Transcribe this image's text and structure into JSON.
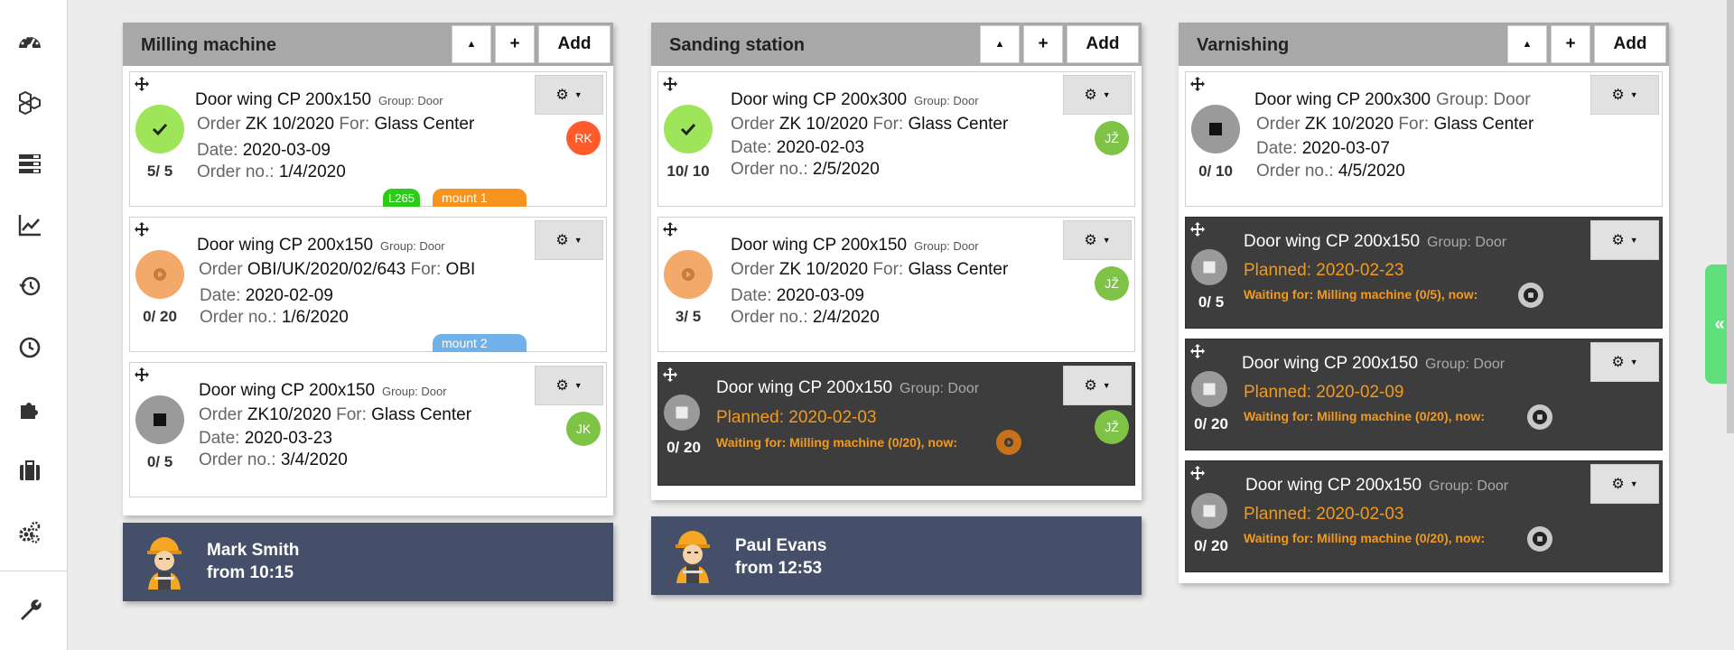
{
  "sidebar": {
    "icons": [
      "dashboard-icon",
      "cubes-icon",
      "list-icon",
      "chart-icon",
      "history-icon",
      "clock-icon",
      "puzzle-icon",
      "briefcase-icon",
      "settings-icon",
      "wrench-icon"
    ]
  },
  "header_buttons": {
    "up": "▲",
    "plus": "+",
    "add": "Add"
  },
  "labels": {
    "group": "Group:",
    "order": "Order",
    "for": "For:",
    "date": "Date:",
    "order_no": "Order no.:",
    "planned": "Planned:",
    "waiting": "Waiting for:",
    "now": "now:"
  },
  "colors": {
    "header": "#a8a8a8",
    "worker_panel": "#454f69",
    "done": "#9ee55a",
    "paused": "#f3a96a",
    "stopped": "#9a9a9a",
    "orange_text": "#f29a1f",
    "side_tab": "#5fe07a"
  },
  "columns": [
    {
      "title": "Milling machine",
      "worker": {
        "name": "Mark Smith",
        "time": "from 10:15"
      },
      "cards": [
        {
          "title": "Door wing CP 200x150",
          "group": "Group: Door",
          "order": "ZK 10/2020",
          "for": "Glass Center",
          "date": "2020-03-09",
          "order_no": "1/4/2020",
          "qty": "5/ 5",
          "status": "done",
          "avatar": "RK",
          "avatar_color": "#ff5a2a",
          "tags": [
            {
              "text": "L265",
              "color": "#2ccc1a"
            },
            {
              "text": "mount 1",
              "color": "#f7941d"
            }
          ]
        },
        {
          "title": "Door wing CP 200x150",
          "group": "Group: Door",
          "order": "OBI/UK/2020/02/643",
          "for": "OBI",
          "date": "2020-02-09",
          "order_no": "1/6/2020",
          "qty": "0/ 20",
          "status": "paused",
          "avatar": "",
          "tags": [
            {
              "text": "mount 2",
              "color": "#6fb1e8"
            }
          ]
        },
        {
          "title": "Door wing CP 200x150",
          "group": "Group: Door",
          "order": "ZK10/2020",
          "for": "Glass Center",
          "date": "2020-03-23",
          "order_no": "3/4/2020",
          "qty": "0/ 5",
          "status": "stopped",
          "avatar": "JK",
          "avatar_color": "#7ec246",
          "tags": []
        }
      ]
    },
    {
      "title": "Sanding station",
      "worker": {
        "name": "Paul Evans",
        "time": "from 12:53"
      },
      "cards": [
        {
          "title": "Door wing CP 200x300",
          "group": "Group: Door",
          "order": "ZK 10/2020",
          "for": "Glass Center",
          "date": "2020-02-03",
          "order_no": "2/5/2020",
          "qty": "10/ 10",
          "status": "done",
          "avatar": "JŽ",
          "avatar_color": "#7ec246"
        },
        {
          "title": "Door wing CP 200x150",
          "group": "Group: Door",
          "order": "ZK 10/2020",
          "for": "Glass Center",
          "date": "2020-03-09",
          "order_no": "2/4/2020",
          "qty": "3/ 5",
          "status": "paused",
          "avatar": "JŽ",
          "avatar_color": "#7ec246"
        },
        {
          "dark": true,
          "title": "Door wing CP 200x150",
          "group": "Group: Door",
          "planned": "Planned: 2020-02-03",
          "waiting": "Waiting for: Milling machine (0/20), now:",
          "qty": "0/ 20",
          "avatar": "JŽ",
          "avatar_color": "#7ec246",
          "wait_icon": "play"
        }
      ]
    },
    {
      "title": "Varnishing",
      "cards": [
        {
          "title": "Door wing CP 200x300",
          "group": "Group: Door",
          "order": "ZK 10/2020",
          "for": "Glass Center",
          "date": "2020-03-07",
          "order_no": "4/5/2020",
          "qty": "0/ 10",
          "status": "stopped",
          "avatar": "",
          "large_group": true
        },
        {
          "dark": true,
          "title": "Door wing CP 200x150",
          "group": "Group: Door",
          "planned": "Planned: 2020-02-23",
          "waiting": "Waiting for: Milling machine (0/5), now:",
          "qty": "0/ 5",
          "wait_icon": "stop"
        },
        {
          "dark": true,
          "title": "Door wing CP 200x150",
          "group": "Group: Door",
          "planned": "Planned: 2020-02-09",
          "waiting": "Waiting for: Milling machine (0/20), now:",
          "qty": "0/ 20",
          "wait_icon": "stop"
        },
        {
          "dark": true,
          "title": "Door wing CP 200x150",
          "group": "Group: Door",
          "planned": "Planned: 2020-02-03",
          "waiting": "Waiting for: Milling machine (0/20), now:",
          "qty": "0/ 20",
          "wait_icon": "stop"
        }
      ]
    }
  ],
  "side_tab": "«"
}
